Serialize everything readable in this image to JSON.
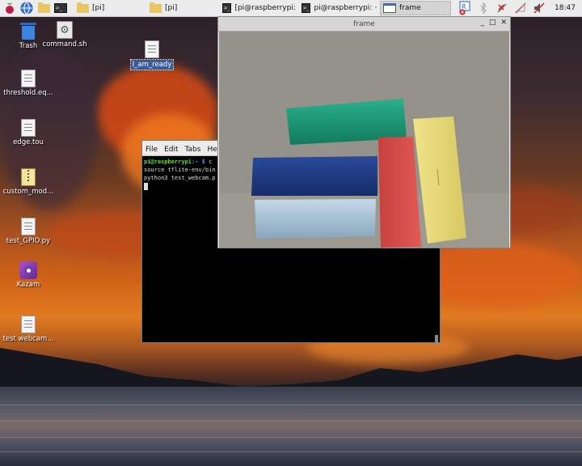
{
  "taskbar": {
    "folder_btn1_label": "[pi]",
    "folder_btn2_label": "[pi]",
    "term_btn1_label": "[pi@raspberrypi: ...",
    "term_btn2_label": "pi@raspberrypi: ~",
    "frame_btn_label": "frame",
    "clock": "18:47"
  },
  "desktop_icons": {
    "trash": "Trash",
    "command": "command.sh",
    "ready": "I_am_ready",
    "threshold": "threshold.eq...",
    "edge": "edge.tou",
    "custom_model": "custom_mod...",
    "test_gpio": "test_GPIO.py",
    "kazam": "Kazam",
    "test_webcam": "test webcam..."
  },
  "terminal": {
    "menu": [
      "File",
      "Edit",
      "Tabs",
      "Hel"
    ],
    "line1_user": "pi@raspberrypi",
    "line1_path": ":~ $",
    "line1_cmd": " c",
    "line2": "source tflite-env/bin",
    "line3": "python3 test_webcam.p"
  },
  "frame_window": {
    "title": "frame"
  },
  "colors": {
    "green_block": "#1e9a78",
    "blue_block": "#1f3a8a",
    "light_blue_block": "#a9c3d8",
    "red_block": "#d84a48",
    "yellow_block": "#e8dc7a"
  }
}
